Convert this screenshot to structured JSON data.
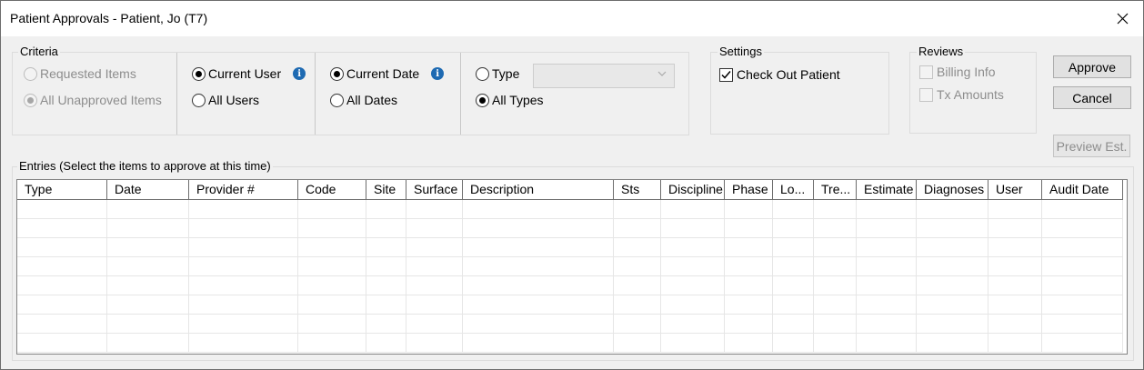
{
  "window": {
    "title": "Patient Approvals - Patient, Jo (T7)",
    "close_icon": "close-icon"
  },
  "criteria": {
    "label": "Criteria",
    "items_options": [
      {
        "label": "Requested Items",
        "checked": false,
        "disabled": true
      },
      {
        "label": "All Unapproved Items",
        "checked": true,
        "disabled": true
      }
    ],
    "user_options": [
      {
        "label": "Current User",
        "checked": true
      },
      {
        "label": "All Users",
        "checked": false
      }
    ],
    "date_options": [
      {
        "label": "Current Date",
        "checked": true
      },
      {
        "label": "All Dates",
        "checked": false
      }
    ],
    "type_options": [
      {
        "label": "Type",
        "checked": false
      },
      {
        "label": "All Types",
        "checked": true
      }
    ],
    "type_select_value": ""
  },
  "settings": {
    "label": "Settings",
    "check_out_patient": {
      "label": "Check Out Patient",
      "checked": true
    }
  },
  "reviews": {
    "label": "Reviews",
    "billing_info": {
      "label": "Billing Info",
      "checked": false
    },
    "tx_amounts": {
      "label": "Tx Amounts",
      "checked": false
    }
  },
  "buttons": {
    "approve": "Approve",
    "cancel": "Cancel",
    "preview_est": "Preview Est."
  },
  "entries": {
    "label": "Entries (Select the items to approve at this time)",
    "columns": [
      "Type",
      "Date",
      "Provider #",
      "Code",
      "Site",
      "Surface",
      "Description",
      "Sts",
      "Discipline",
      "Phase",
      "Lo...",
      "Tre...",
      "Estimate",
      "Diagnoses",
      "User",
      "Audit Date"
    ],
    "rows": []
  }
}
